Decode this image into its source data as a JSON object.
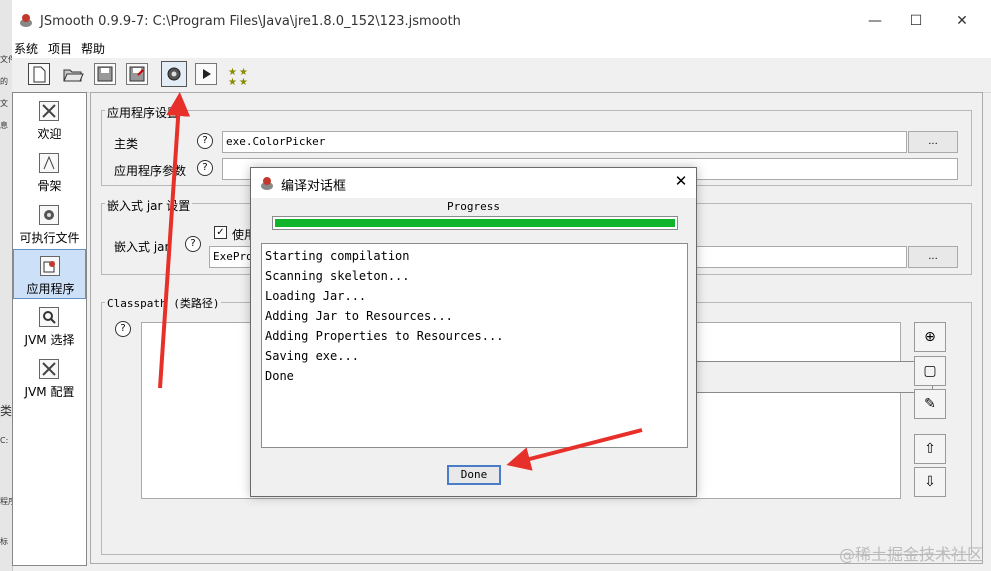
{
  "window": {
    "title": "JSmooth 0.9.9-7: C:\\Program Files\\Java\\jre1.8.0_152\\123.jsmooth"
  },
  "menu": [
    "系统",
    "项目",
    "帮助"
  ],
  "background_window": {
    "fragments": [
      "文件",
      "的",
      "文",
      "息",
      "类",
      "C:",
      "程序",
      "标"
    ]
  },
  "sidebar": {
    "items": [
      {
        "label": "欢迎",
        "icon": "welcome-icon"
      },
      {
        "label": "骨架",
        "icon": "skeleton-icon"
      },
      {
        "label": "可执行文件",
        "icon": "executable-icon"
      },
      {
        "label": "应用程序",
        "icon": "application-icon",
        "selected": true
      },
      {
        "label": "JVM 选择",
        "icon": "jvm-select-icon"
      },
      {
        "label": "JVM 配置",
        "icon": "jvm-config-icon"
      }
    ]
  },
  "app_settings": {
    "title": "应用程序设置",
    "main_class_label": "主类",
    "main_class_value": "exe.ColorPicker",
    "args_label": "应用程序参数",
    "args_value": "",
    "browse_label": "..."
  },
  "embedded_jar": {
    "title": "嵌入式 jar 设置",
    "label": "嵌入式 jar",
    "checkbox_label": "使用",
    "jar_value": "ExePro",
    "browse_label": "..."
  },
  "classpath": {
    "title": "Classpath (类路径)"
  },
  "dialog": {
    "title": "编译对话框",
    "progress_label": "Progress",
    "progress": 1.0,
    "log_lines": [
      "Starting compilation",
      "Scanning skeleton...",
      "Loading Jar...",
      "Adding Jar to Resources...",
      "Adding Properties to Resources...",
      "Saving exe...",
      "Done"
    ],
    "done_label": "Done"
  },
  "colors": {
    "progress": "#11b52c",
    "arrow": "#e8302a",
    "selection": "#cce0f8"
  },
  "watermark": "@稀土掘金技术社区"
}
